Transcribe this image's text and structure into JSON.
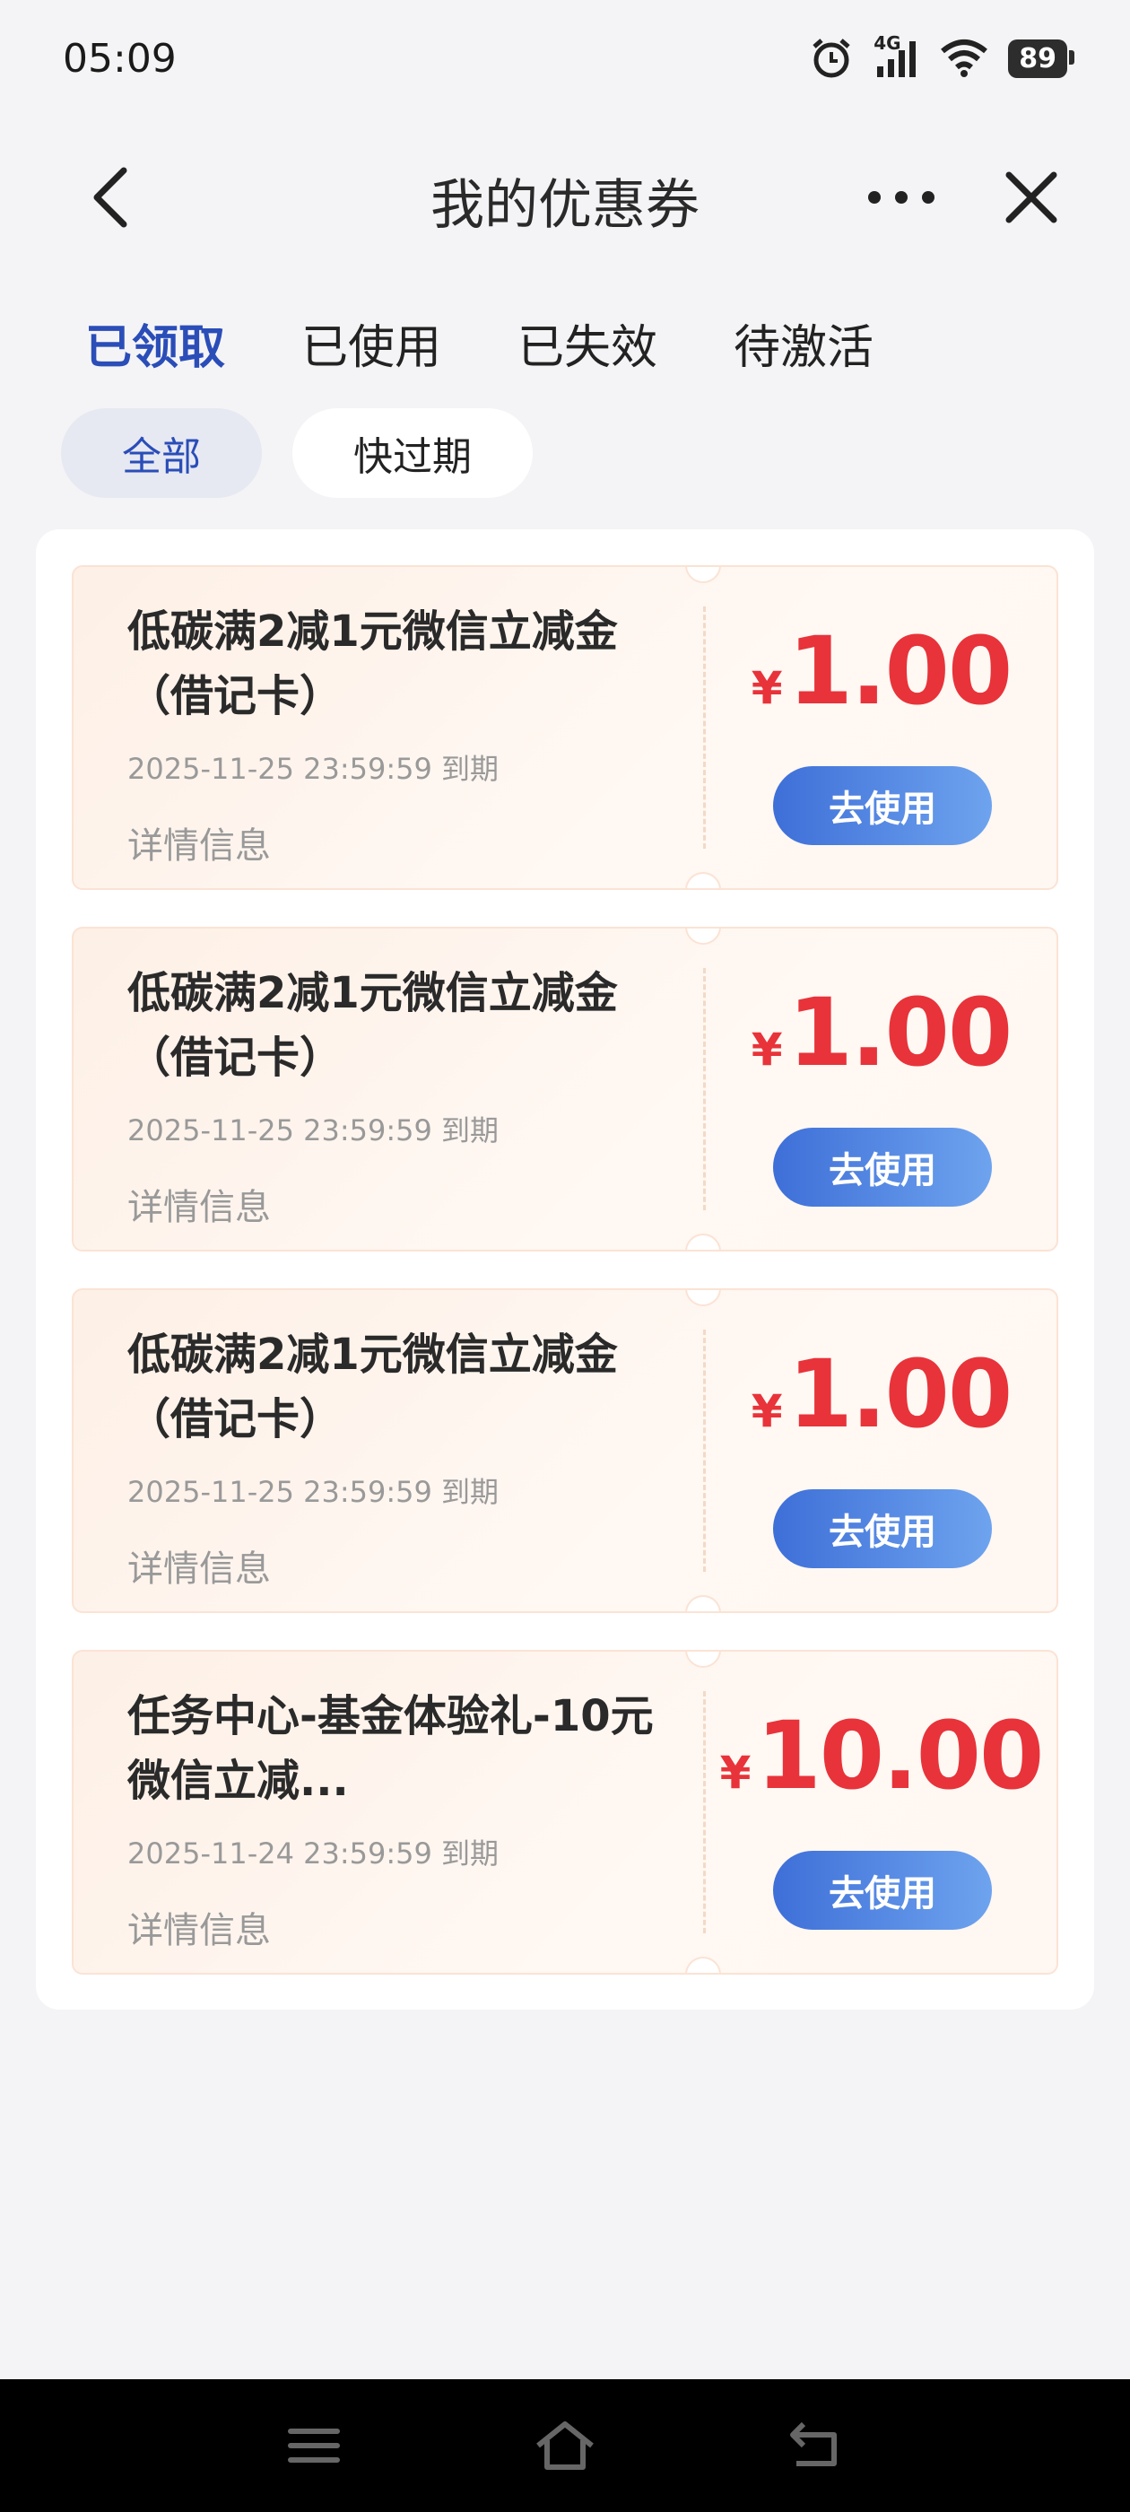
{
  "status_bar": {
    "time": "05:09",
    "network": "4G",
    "battery": "89"
  },
  "nav": {
    "title": "我的优惠券"
  },
  "tabs": [
    {
      "label": "已领取",
      "active": true
    },
    {
      "label": "已使用",
      "active": false
    },
    {
      "label": "已失效",
      "active": false
    },
    {
      "label": "待激活",
      "active": false
    }
  ],
  "filters": [
    {
      "label": "全部",
      "active": true
    },
    {
      "label": "快过期",
      "active": false
    }
  ],
  "coupons": [
    {
      "title": "低碳满2减1元微信立减金（借记卡）",
      "expiry": "2025-11-25 23:59:59 到期",
      "detail": "详情信息",
      "currency": "¥",
      "amount": "1.00",
      "button": "去使用"
    },
    {
      "title": "低碳满2减1元微信立减金（借记卡）",
      "expiry": "2025-11-25 23:59:59 到期",
      "detail": "详情信息",
      "currency": "¥",
      "amount": "1.00",
      "button": "去使用"
    },
    {
      "title": "低碳满2减1元微信立减金（借记卡）",
      "expiry": "2025-11-25 23:59:59 到期",
      "detail": "详情信息",
      "currency": "¥",
      "amount": "1.00",
      "button": "去使用"
    },
    {
      "title": "任务中心-基金体验礼-10元微信立减...",
      "expiry": "2025-11-24 23:59:59 到期",
      "detail": "详情信息",
      "currency": "¥",
      "amount": "10.00",
      "button": "去使用"
    }
  ],
  "colors": {
    "accent": "#2a4db8",
    "price": "#e8333a",
    "button": "#3e6fd8"
  }
}
